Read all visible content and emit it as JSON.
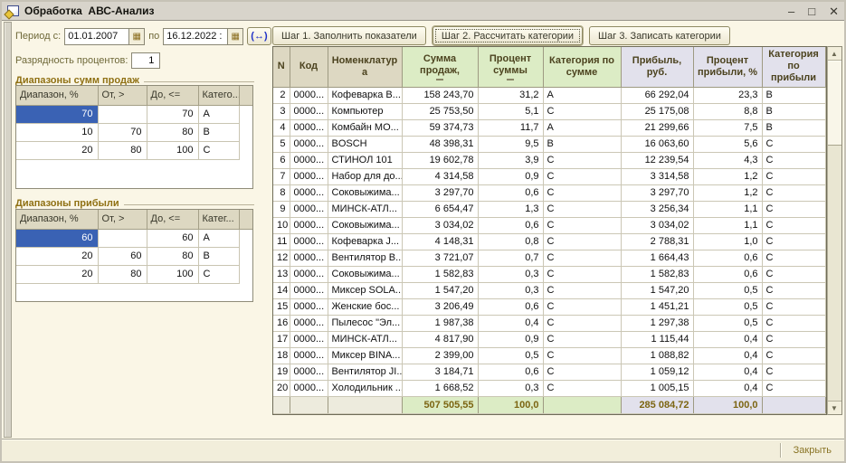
{
  "window": {
    "title": "Обработка  АВС-Анализ",
    "minimize": "–",
    "maximize": "□",
    "close": "✕"
  },
  "icons": {
    "calendar": "▦",
    "range_select": "(↔)",
    "scroll_up": "▲",
    "scroll_down": "▼"
  },
  "period": {
    "label_from": "Период с:",
    "from": "01.01.2007",
    "label_to": "по",
    "to": "16.12.2022 :"
  },
  "precision": {
    "label": "Разрядность процентов:",
    "value": "1"
  },
  "sales_ranges": {
    "title": "Диапазоны сумм продаж",
    "columns": [
      "Диапазон, %",
      "От, >",
      "До, <=",
      "Катего..."
    ],
    "rows": [
      [
        "70",
        "",
        "70",
        "A"
      ],
      [
        "10",
        "70",
        "80",
        "B"
      ],
      [
        "20",
        "80",
        "100",
        "C"
      ]
    ]
  },
  "profit_ranges": {
    "title": "Диапазоны прибыли",
    "columns": [
      "Диапазон, %",
      "От, >",
      "До, <=",
      "Катег..."
    ],
    "rows": [
      [
        "60",
        "",
        "60",
        "A"
      ],
      [
        "20",
        "60",
        "80",
        "B"
      ],
      [
        "20",
        "80",
        "100",
        "C"
      ]
    ]
  },
  "steps": [
    {
      "label": "Шаг 1. Заполнить показатели"
    },
    {
      "label": "Шаг 2. Рассчитать категории"
    },
    {
      "label": "Шаг 3. Записать категории"
    }
  ],
  "main_table": {
    "columns": [
      "N",
      "Код",
      "Номенклатура",
      "Сумма продаж,",
      "Процент суммы",
      "Категория по сумме",
      "Прибыль, руб.",
      "Процент прибыли, %",
      "Категория по прибыли"
    ],
    "sorted_columns": [
      3,
      4
    ],
    "rows": [
      [
        "2",
        "0000...",
        "Кофеварка В...",
        "158 243,70",
        "31,2",
        "A",
        "66 292,04",
        "23,3",
        "B"
      ],
      [
        "3",
        "0000...",
        "Компьютер",
        "25 753,50",
        "5,1",
        "C",
        "25 175,08",
        "8,8",
        "B"
      ],
      [
        "4",
        "0000...",
        "Комбайн МО...",
        "59 374,73",
        "11,7",
        "A",
        "21 299,66",
        "7,5",
        "B"
      ],
      [
        "5",
        "0000...",
        "BOSCH",
        "48 398,31",
        "9,5",
        "B",
        "16 063,60",
        "5,6",
        "C"
      ],
      [
        "6",
        "0000...",
        "СТИНОЛ 101",
        "19 602,78",
        "3,9",
        "C",
        "12 239,54",
        "4,3",
        "C"
      ],
      [
        "7",
        "0000...",
        "Набор для до...",
        "4 314,58",
        "0,9",
        "C",
        "3 314,58",
        "1,2",
        "C"
      ],
      [
        "8",
        "0000...",
        "Соковыжима...",
        "3 297,70",
        "0,6",
        "C",
        "3 297,70",
        "1,2",
        "C"
      ],
      [
        "9",
        "0000...",
        "МИНСК-АТЛ...",
        "6 654,47",
        "1,3",
        "C",
        "3 256,34",
        "1,1",
        "C"
      ],
      [
        "10",
        "0000...",
        "Соковыжима...",
        "3 034,02",
        "0,6",
        "C",
        "3 034,02",
        "1,1",
        "C"
      ],
      [
        "11",
        "0000...",
        "Кофеварка J...",
        "4 148,31",
        "0,8",
        "C",
        "2 788,31",
        "1,0",
        "C"
      ],
      [
        "12",
        "0000...",
        "Вентилятор В...",
        "3 721,07",
        "0,7",
        "C",
        "1 664,43",
        "0,6",
        "C"
      ],
      [
        "13",
        "0000...",
        "Соковыжима...",
        "1 582,83",
        "0,3",
        "C",
        "1 582,83",
        "0,6",
        "C"
      ],
      [
        "14",
        "0000...",
        "Миксер SOLA...",
        "1 547,20",
        "0,3",
        "C",
        "1 547,20",
        "0,5",
        "C"
      ],
      [
        "15",
        "0000...",
        "Женские бос...",
        "3 206,49",
        "0,6",
        "C",
        "1 451,21",
        "0,5",
        "C"
      ],
      [
        "16",
        "0000...",
        "Пылесос \"Эл...",
        "1 987,38",
        "0,4",
        "C",
        "1 297,38",
        "0,5",
        "C"
      ],
      [
        "17",
        "0000...",
        "МИНСК-АТЛ...",
        "4 817,90",
        "0,9",
        "C",
        "1 115,44",
        "0,4",
        "C"
      ],
      [
        "18",
        "0000...",
        "Миксер BINA...",
        "2 399,00",
        "0,5",
        "C",
        "1 088,82",
        "0,4",
        "C"
      ],
      [
        "19",
        "0000...",
        "Вентилятор JI...",
        "3 184,71",
        "0,6",
        "C",
        "1 059,12",
        "0,4",
        "C"
      ],
      [
        "20",
        "0000...",
        "Холодильник ...",
        "1 668,52",
        "0,3",
        "C",
        "1 005,15",
        "0,4",
        "C"
      ]
    ],
    "totals_row": [
      "",
      "",
      "",
      "507 505,55",
      "100,0",
      "",
      "285 084,72",
      "100,0",
      ""
    ]
  },
  "bottom": {
    "close_label": "Закрыть"
  }
}
